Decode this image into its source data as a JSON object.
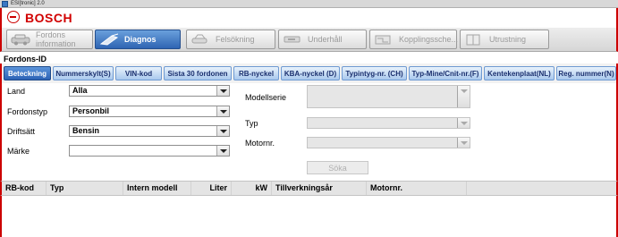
{
  "window": {
    "title": "ESI[tronic] 2.0"
  },
  "brand": {
    "name": "BOSCH"
  },
  "nav": {
    "tabs": [
      {
        "label": "Fordons\ninformation",
        "icon": "car-icon"
      },
      {
        "label": "Diagnos",
        "icon": "diagnostic-probe-icon"
      },
      {
        "label": "Felsökning",
        "icon": "car-search-icon"
      },
      {
        "label": "Underhåll",
        "icon": "wrench-icon"
      },
      {
        "label": "Kopplingssche...",
        "icon": "circuit-diagram-icon"
      },
      {
        "label": "Utrustning",
        "icon": "book-icon"
      }
    ],
    "active_index": 1
  },
  "section": {
    "title": "Fordons-ID"
  },
  "filters": {
    "tabs": [
      "Beteckning",
      "Nummerskylt(S)",
      "VIN-kod",
      "Sista 30 fordonen",
      "RB-nyckel",
      "KBA-nyckel (D)",
      "Typintyg-nr. (CH)",
      "Typ-Mine/Cnit-nr.(F)",
      "Kentekenplaat(NL)",
      "Reg. nummer(N)"
    ],
    "active_index": 0
  },
  "form": {
    "land": {
      "label": "Land",
      "value": "Alla"
    },
    "fordonstyp": {
      "label": "Fordonstyp",
      "value": "Personbil"
    },
    "driftsatt": {
      "label": "Driftsätt",
      "value": "Bensin"
    },
    "marke": {
      "label": "Märke",
      "value": ""
    },
    "modellserie": {
      "label": "Modellserie",
      "value": ""
    },
    "typ": {
      "label": "Typ",
      "value": ""
    },
    "motornr": {
      "label": "Motornr.",
      "value": ""
    },
    "search_button": "Söka"
  },
  "results": {
    "columns": [
      "RB-kod",
      "Typ",
      "Intern modell",
      "Liter",
      "kW",
      "Tillverkningsår",
      "Motornr."
    ]
  },
  "colors": {
    "brand_red": "#d10000",
    "active_blue": "#2e64b3"
  }
}
